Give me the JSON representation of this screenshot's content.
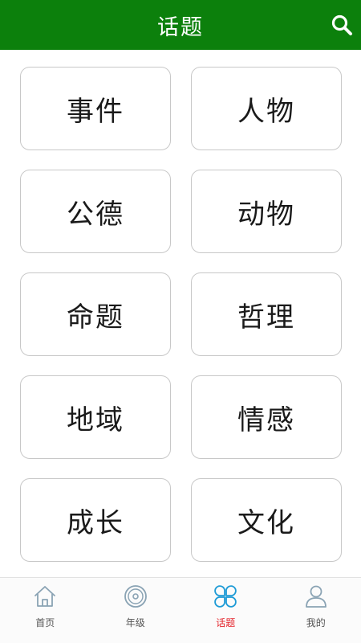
{
  "header": {
    "title": "话题",
    "search_icon": "search-icon"
  },
  "topics": [
    {
      "label": "事件"
    },
    {
      "label": "人物"
    },
    {
      "label": "公德"
    },
    {
      "label": "动物"
    },
    {
      "label": "命题"
    },
    {
      "label": "哲理"
    },
    {
      "label": "地域"
    },
    {
      "label": "情感"
    },
    {
      "label": "成长"
    },
    {
      "label": "文化"
    }
  ],
  "tabbar": {
    "items": [
      {
        "label": "首页",
        "icon": "home-icon",
        "active": false
      },
      {
        "label": "年级",
        "icon": "disc-icon",
        "active": false
      },
      {
        "label": "话题",
        "icon": "clover-icon",
        "active": true
      },
      {
        "label": "我的",
        "icon": "user-icon",
        "active": false
      }
    ]
  },
  "colors": {
    "header_bg": "#0c800c",
    "active_tab_text": "#e4242b",
    "active_tab_icon": "#1e9bd6",
    "inactive_icon": "#8aa3b4"
  }
}
